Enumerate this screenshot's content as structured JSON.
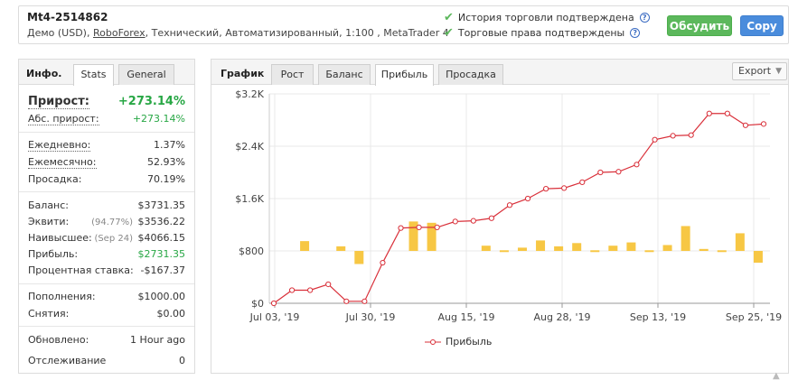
{
  "header": {
    "account_name": "Mt4-2514862",
    "desc_prefix": "Демо (USD),",
    "broker": "RoboForex",
    "desc_suffix": ", Технический, Автоматизированный, 1:100 , MetaTrader 4",
    "verified_history": "История торговли подтверждена",
    "verified_rights": "Торговые права подтверждены",
    "discuss_label": "Обсудить",
    "copy_label": "Copy"
  },
  "left_tabs": {
    "info": "Инфо.",
    "stats": "Stats",
    "general": "General"
  },
  "stats": {
    "gain_label": "Прирост:",
    "gain": "+273.14%",
    "abs_gain_label": "Абс. прирост:",
    "abs_gain": "+273.14%",
    "daily_label": "Ежедневно:",
    "daily": "1.37%",
    "monthly_label": "Ежемесячно:",
    "monthly": "52.93%",
    "drawdown_label": "Просадка:",
    "drawdown": "70.19%",
    "balance_label": "Баланс:",
    "balance": "$3731.35",
    "equity_label": "Эквити:",
    "equity_pct": "(94.77%)",
    "equity": "$3536.22",
    "highest_label": "Наивысшее:",
    "highest_date": "(Sep 24)",
    "highest": "$4066.15",
    "profit_label": "Прибыль:",
    "profit": "$2731.35",
    "interest_label": "Процентная ставка:",
    "interest": "-$167.37",
    "deposits_label": "Пополнения:",
    "deposits": "$1000.00",
    "withdrawals_label": "Снятия:",
    "withdrawals": "$0.00",
    "updated_label": "Обновлено:",
    "updated": "1 Hour ago",
    "tracking_label": "Отслеживание",
    "tracking": "0"
  },
  "right_tabs": {
    "graph": "График",
    "growth": "Рост",
    "balance": "Баланс",
    "profit": "Прибыль",
    "drawdown": "Просадка",
    "export": "Export"
  },
  "chart_data": {
    "type": "line",
    "x_labels": [
      "Jul 03, '19",
      "Jul 30, '19",
      "Aug 15, '19",
      "Aug 28, '19",
      "Sep 13, '19",
      "Sep 25, '19"
    ],
    "y_ticks": [
      "$0",
      "$800",
      "$1.6K",
      "$2.4K",
      "$3.2K"
    ],
    "ylim": [
      0,
      3200
    ],
    "series": [
      {
        "name": "Прибыль",
        "type": "line",
        "color": "#d9303a",
        "values": [
          0,
          200,
          200,
          290,
          30,
          30,
          620,
          1150,
          1160,
          1160,
          1250,
          1260,
          1300,
          1500,
          1600,
          1750,
          1760,
          1850,
          2000,
          2010,
          2120,
          2500,
          2560,
          2570,
          2900,
          2900,
          2720,
          2740
        ]
      },
      {
        "name": "bars",
        "type": "bar",
        "color": "#f7c744",
        "values": [
          0,
          150,
          0,
          70,
          -200,
          0,
          0,
          450,
          430,
          0,
          0,
          80,
          10,
          50,
          160,
          70,
          120,
          10,
          80,
          130,
          10,
          90,
          380,
          30,
          10,
          270,
          -180,
          20
        ]
      }
    ],
    "legend": "bottom-center"
  }
}
